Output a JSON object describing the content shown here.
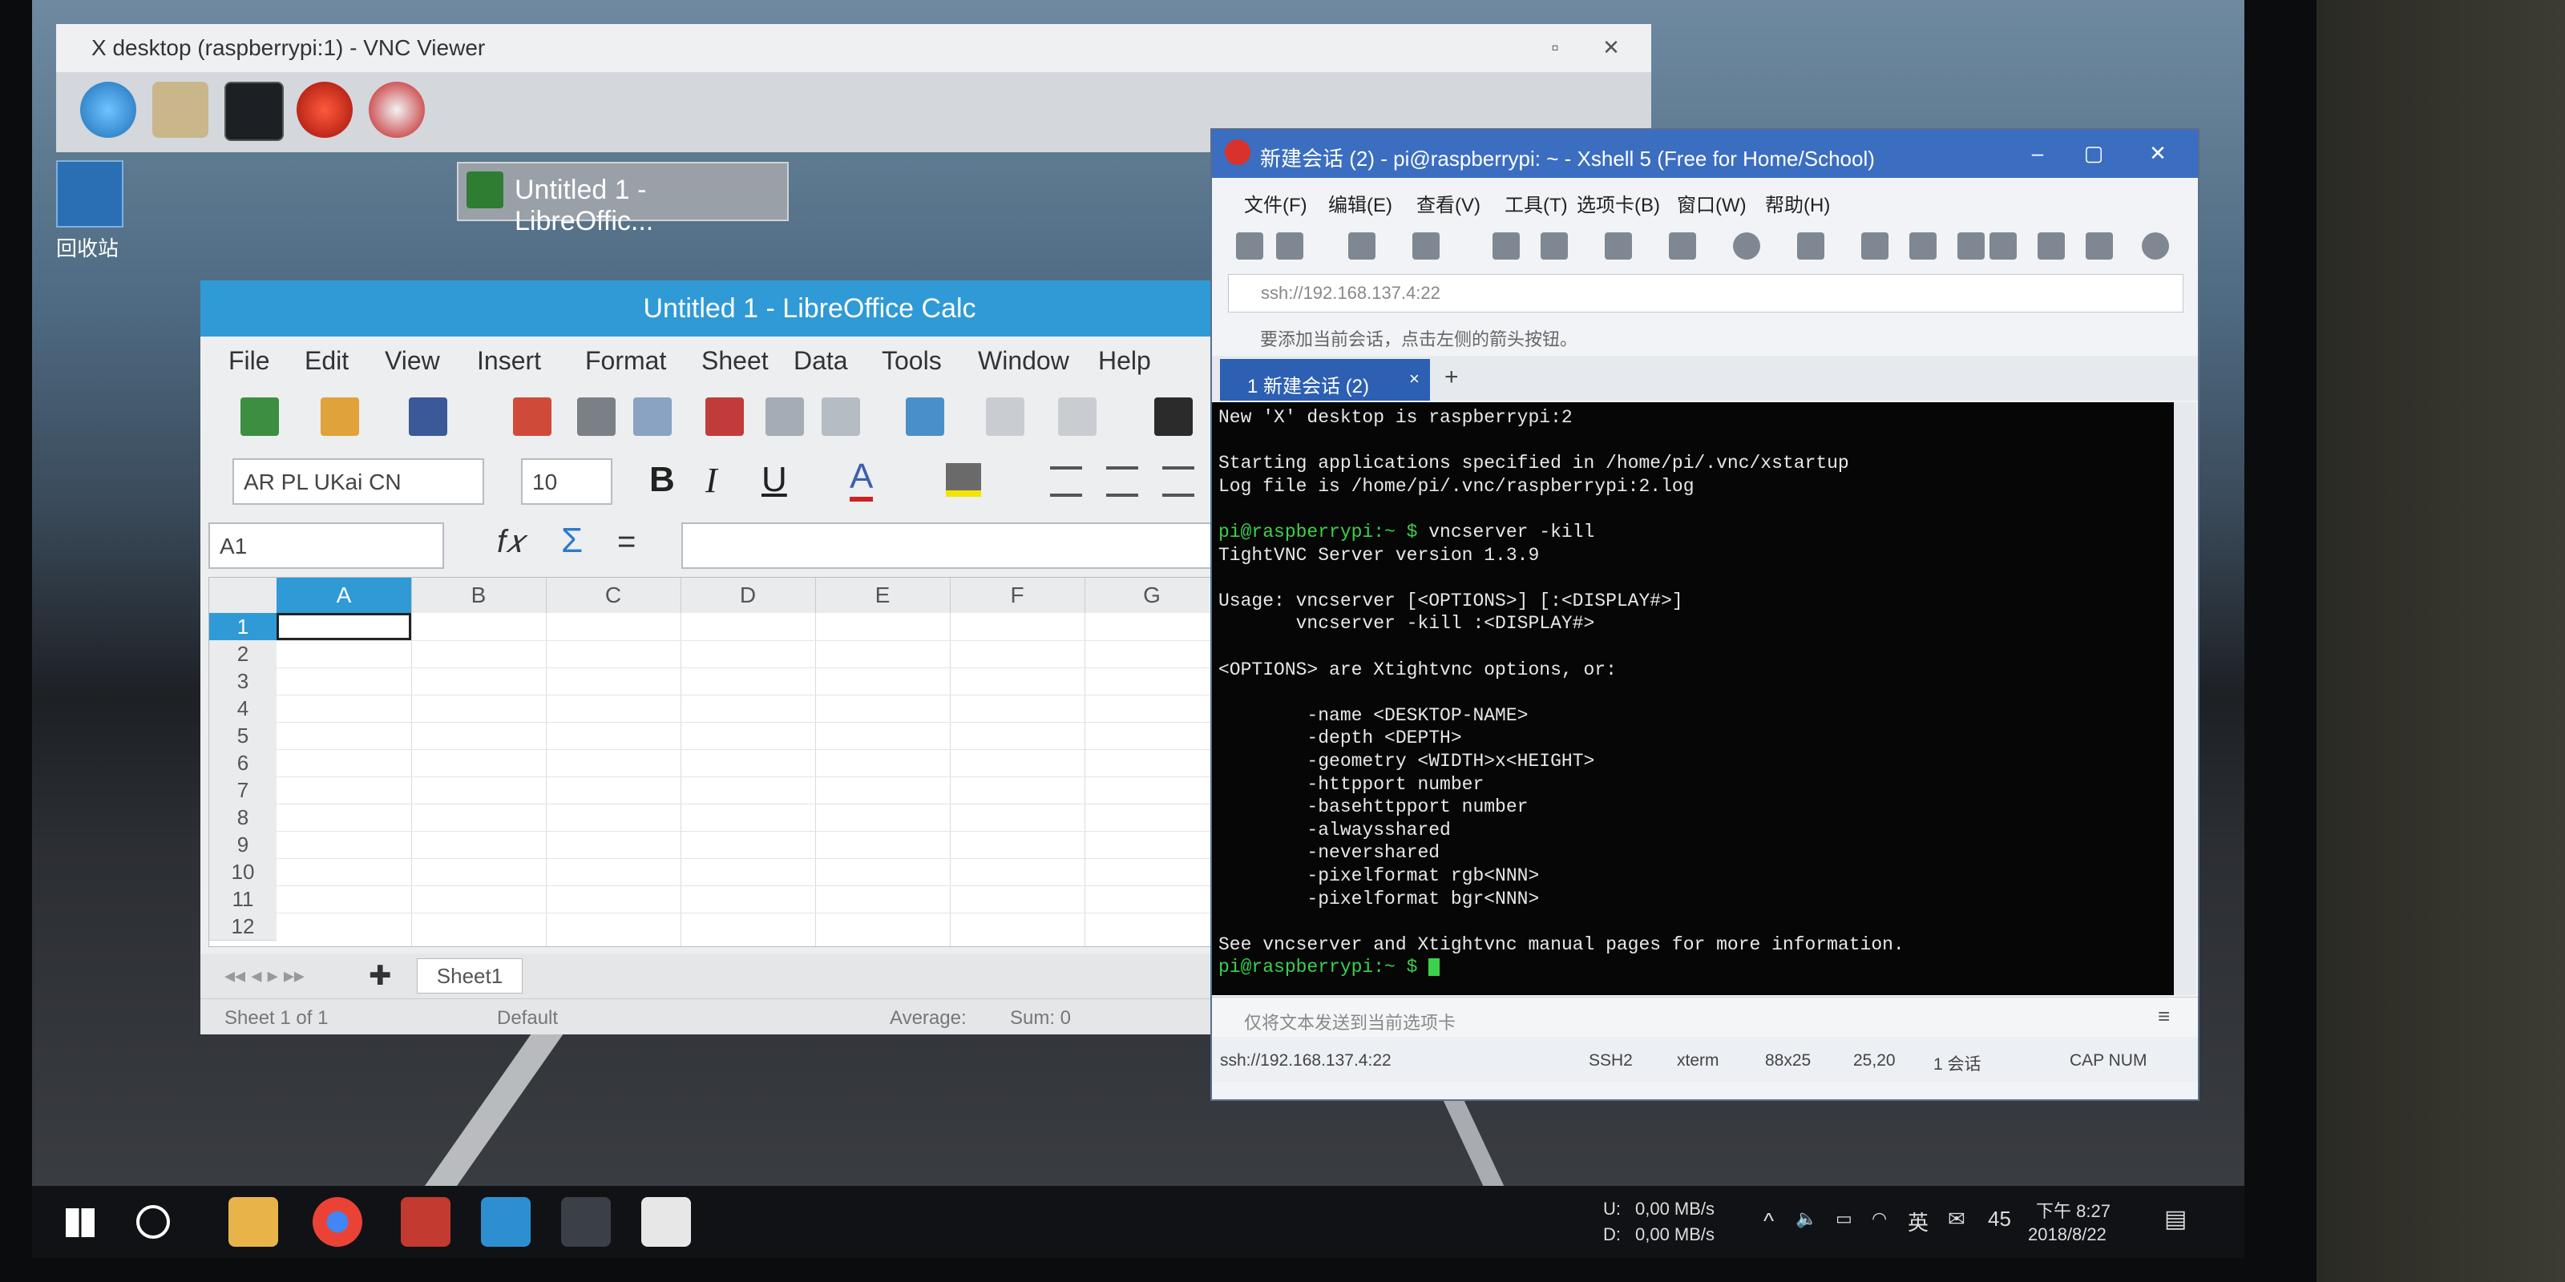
{
  "vnc": {
    "window_title": "X desktop (raspberrypi:1) - VNC Viewer",
    "active_task": "Untitled 1 - LibreOffic..."
  },
  "desktop": {
    "recycle_bin_label": "回收站"
  },
  "calc": {
    "window_title": "Untitled 1 - LibreOffice Calc",
    "menu": [
      "File",
      "Edit",
      "View",
      "Insert",
      "Format",
      "Sheet",
      "Data",
      "Tools",
      "Window",
      "Help"
    ],
    "font_name": "AR PL UKai CN",
    "font_size": "10",
    "name_box": "A1",
    "columns": [
      "A",
      "B",
      "C",
      "D",
      "E",
      "F",
      "G"
    ],
    "rows": [
      "1",
      "2",
      "3",
      "4",
      "5",
      "6",
      "7",
      "8",
      "9",
      "10",
      "11",
      "12"
    ],
    "sheet_tab": "Sheet1",
    "status": {
      "sheet_of": "Sheet 1 of 1",
      "page_style": "Default",
      "average": "Average:",
      "sum": "Sum: 0"
    }
  },
  "xshell": {
    "window_title": "新建会话 (2) - pi@raspberrypi: ~ - Xshell 5 (Free for Home/School)",
    "menu": [
      "文件(F)",
      "编辑(E)",
      "查看(V)",
      "工具(T)",
      "选项卡(B)",
      "窗口(W)",
      "帮助(H)"
    ],
    "address": "ssh://192.168.137.4:22",
    "hint": "要添加当前会话，点击左侧的箭头按钮。",
    "tab_label": "1 新建会话 (2)",
    "send_placeholder": "仅将文本发送到当前选项卡",
    "terminal_lines": [
      {
        "t": "New 'X' desktop is raspberrypi:2",
        "p": false
      },
      {
        "t": "",
        "p": false
      },
      {
        "t": "Starting applications specified in /home/pi/.vnc/xstartup",
        "p": false
      },
      {
        "t": "Log file is /home/pi/.vnc/raspberrypi:2.log",
        "p": false
      },
      {
        "t": "",
        "p": false
      },
      {
        "t": "pi@raspberrypi:~ $ vncserver -kill",
        "p": true
      },
      {
        "t": "TightVNC Server version 1.3.9",
        "p": false
      },
      {
        "t": "",
        "p": false
      },
      {
        "t": "Usage: vncserver [<OPTIONS>] [:<DISPLAY#>]",
        "p": false
      },
      {
        "t": "       vncserver -kill :<DISPLAY#>",
        "p": false
      },
      {
        "t": "",
        "p": false
      },
      {
        "t": "<OPTIONS> are Xtightvnc options, or:",
        "p": false
      },
      {
        "t": "",
        "p": false
      },
      {
        "t": "        -name <DESKTOP-NAME>",
        "p": false
      },
      {
        "t": "        -depth <DEPTH>",
        "p": false
      },
      {
        "t": "        -geometry <WIDTH>x<HEIGHT>",
        "p": false
      },
      {
        "t": "        -httpport number",
        "p": false
      },
      {
        "t": "        -basehttpport number",
        "p": false
      },
      {
        "t": "        -alwaysshared",
        "p": false
      },
      {
        "t": "        -nevershared",
        "p": false
      },
      {
        "t": "        -pixelformat rgb<NNN>",
        "p": false
      },
      {
        "t": "        -pixelformat bgr<NNN>",
        "p": false
      },
      {
        "t": "",
        "p": false
      },
      {
        "t": "See vncserver and Xtightvnc manual pages for more information.",
        "p": false
      },
      {
        "t": "pi@raspberrypi:~ $ ",
        "p": true
      }
    ],
    "status": {
      "address": "ssh://192.168.137.4:22",
      "protocol": "SSH2",
      "term": "xterm",
      "size": "88x25",
      "cursor": "25,20",
      "sessions": "1 会话",
      "keys": "CAP NUM"
    }
  },
  "taskbar": {
    "net_up": "0,00 MB/s",
    "net_down": "0,00 MB/s",
    "net_u_label": "U:",
    "net_d_label": "D:",
    "ime": "英",
    "volume_level": "45",
    "time": "下午 8:27",
    "date": "2018/8/22"
  }
}
